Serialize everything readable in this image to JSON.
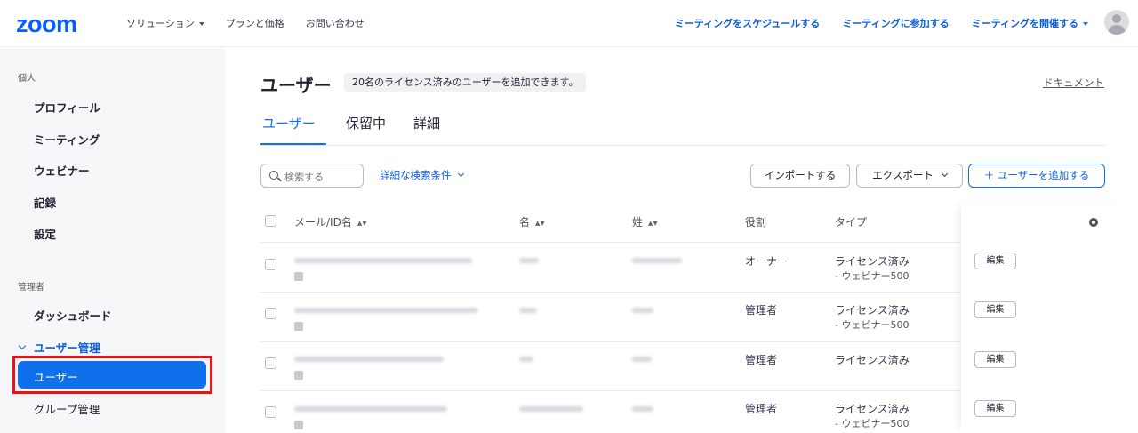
{
  "header": {
    "logo": "zoom",
    "nav_left": [
      "ソリューション",
      "プランと価格",
      "お問い合わせ"
    ],
    "nav_right": [
      "ミーティングをスケジュールする",
      "ミーティングに参加する",
      "ミーティングを開催する"
    ]
  },
  "sidebar": {
    "personal_label": "個人",
    "personal_items": [
      "プロフィール",
      "ミーティング",
      "ウェビナー",
      "記録",
      "設定"
    ],
    "admin_label": "管理者",
    "dashboard": "ダッシュボード",
    "user_mgmt": "ユーザー管理",
    "users_active": "ユーザー",
    "group_mgmt": "グループ管理"
  },
  "main": {
    "title": "ユーザー",
    "license_note": "20名のライセンス済みのユーザーを追加できます。",
    "doc_link": "ドキュメント",
    "tabs": [
      "ユーザー",
      "保留中",
      "詳細"
    ],
    "search_placeholder": "検索する",
    "advanced_search": "詳細な検索条件",
    "import_btn": "インポートする",
    "export_btn": "エクスポート",
    "add_user_btn": "＋ ユーザーを追加する",
    "columns": {
      "email": "メール/ID名",
      "first": "名",
      "last": "姓",
      "role": "役割",
      "type": "タイプ"
    },
    "sort_glyph": "▲▼",
    "edit_label": "編集",
    "rows": [
      {
        "role": "オーナー",
        "type": "ライセンス済み",
        "type_sub": "- ウェビナー500"
      },
      {
        "role": "管理者",
        "type": "ライセンス済み",
        "type_sub": "- ウェビナー500"
      },
      {
        "role": "管理者",
        "type": "ライセンス済み",
        "type_sub": ""
      },
      {
        "role": "管理者",
        "type": "ライセンス済み",
        "type_sub": "- ウェビナー500"
      }
    ]
  }
}
